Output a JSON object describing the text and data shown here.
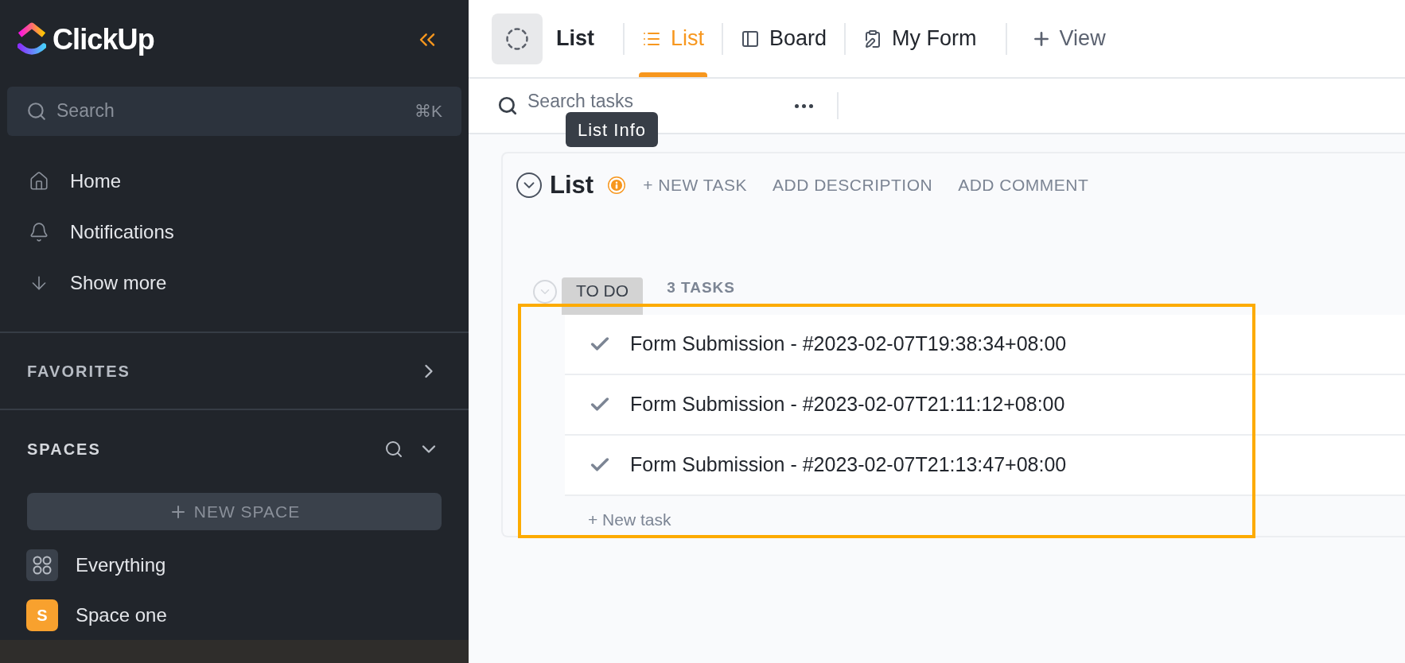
{
  "sidebar": {
    "logo": "ClickUp",
    "search": {
      "placeholder": "Search",
      "shortcut": "⌘K"
    },
    "nav": [
      {
        "label": "Home",
        "kind": "home"
      },
      {
        "label": "Notifications",
        "kind": "bell"
      },
      {
        "label": "Show more",
        "kind": "more"
      }
    ],
    "favorites": {
      "title": "FAVORITES"
    },
    "spaces": {
      "title": "SPACES",
      "new_space": "NEW SPACE",
      "items": [
        {
          "label": "Everything",
          "kind": "everything"
        },
        {
          "label": "Space one",
          "kind": "space",
          "badge": "S",
          "color": "#f8a12e"
        }
      ]
    }
  },
  "header": {
    "title": "List",
    "views": [
      {
        "label": "List",
        "kind": "list",
        "selected": true
      },
      {
        "label": "Board",
        "kind": "board",
        "selected": false
      },
      {
        "label": "My Form",
        "kind": "form",
        "selected": false
      }
    ],
    "add_view": "View"
  },
  "toolbar": {
    "search_placeholder": "Search tasks"
  },
  "tooltip": "List Info",
  "list": {
    "title": "List",
    "actions": [
      "+ NEW TASK",
      "ADD DESCRIPTION",
      "ADD COMMENT"
    ],
    "group": {
      "status": "TO DO",
      "count": "3 TASKS"
    },
    "tasks": [
      {
        "name": "Form Submission - #2023-02-07T19:38:34+08:00"
      },
      {
        "name": "Form Submission - #2023-02-07T21:11:12+08:00"
      },
      {
        "name": "Form Submission - #2023-02-07T21:13:47+08:00"
      }
    ],
    "new_task": "+ New task"
  }
}
